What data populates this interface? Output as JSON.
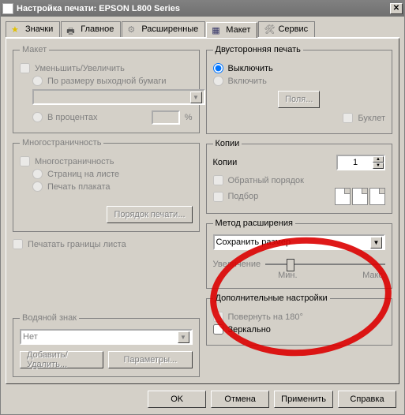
{
  "window": {
    "title": "Настройка печати: EPSON L800 Series"
  },
  "tabs": {
    "icons": "Значки",
    "main": "Главное",
    "advanced": "Расширенные",
    "layout": "Макет",
    "service": "Сервис"
  },
  "layout_group": {
    "legend": "Макет",
    "reduce_enlarge": "Уменьшить/Увеличить",
    "by_output_paper": "По размеру выходной бумаги",
    "in_percent": "В процентах",
    "percent_sign": "%"
  },
  "multipage": {
    "legend": "Многостраничность",
    "pages_per_sheet": "Страниц на листе",
    "poster": "Печать плаката",
    "order_btn": "Порядок печати..."
  },
  "print_borders": "Печатать границы листа",
  "watermark": {
    "legend": "Водяной знак",
    "none": "Нет",
    "add_remove": "Добавить/Удалить...",
    "params": "Параметры..."
  },
  "duplex": {
    "legend": "Двусторонняя печать",
    "off": "Выключить",
    "on": "Включить",
    "margins_btn": "Поля...",
    "booklet": "Буклет"
  },
  "copies": {
    "legend": "Копии",
    "label": "Копии",
    "value": "1",
    "reverse": "Обратный порядок",
    "collate": "Подбор"
  },
  "expand": {
    "legend": "Метод расширения",
    "selected": "Сохранить размер",
    "zoom_label": "Увеличение",
    "min": "Мин.",
    "max": "Макс."
  },
  "more": {
    "legend": "Дополнительные настройки",
    "rotate180": "Повернуть на 180°",
    "mirror": "Зеркально"
  },
  "footer": {
    "ok": "OK",
    "cancel": "Отмена",
    "apply": "Применить",
    "help": "Справка"
  }
}
